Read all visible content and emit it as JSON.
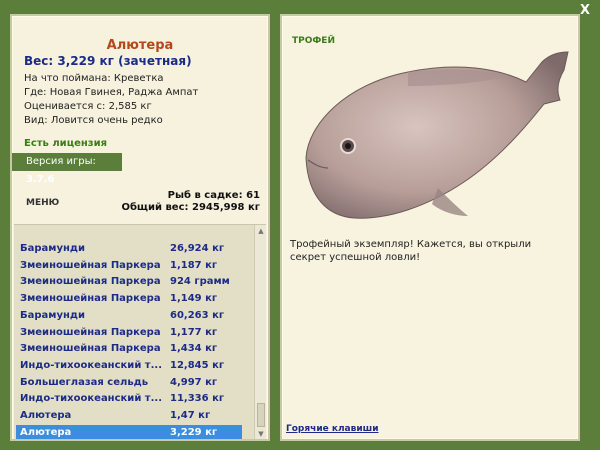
{
  "close_label": "X",
  "fish": {
    "name": "Алютера",
    "weight": "Вес: 3,229 кг (зачетная)",
    "bait": "На что поймана: Креветка",
    "place": "Где: Новая Гвинея, Раджа Ампат",
    "price": "Оценивается с: 2,585 кг",
    "rarity": "Вид: Ловится очень редко"
  },
  "license": "Есть лицензия",
  "version": {
    "label": "Версия игры:",
    "value": "3.7.6"
  },
  "menu_label": "МЕНЮ",
  "stats": {
    "count": "Рыб в садке: 61",
    "total": "Общий вес: 2945,998 кг"
  },
  "catch_list": [
    {
      "name": "Барамунди",
      "weight": "26,924 кг"
    },
    {
      "name": "Змеиношейная Паркера",
      "weight": "1,187 кг"
    },
    {
      "name": "Змеиношейная Паркера",
      "weight": "924 грамм"
    },
    {
      "name": "Змеиношейная Паркера",
      "weight": "1,149 кг"
    },
    {
      "name": "Барамунди",
      "weight": "60,263 кг"
    },
    {
      "name": "Змеиношейная Паркера",
      "weight": "1,177 кг"
    },
    {
      "name": "Змеиношейная Паркера",
      "weight": "1,434 кг"
    },
    {
      "name": "Индо-тихоокеанский т...",
      "weight": "12,845 кг"
    },
    {
      "name": "Большеглазая сельдь",
      "weight": "4,997 кг"
    },
    {
      "name": "Индо-тихоокеанский т...",
      "weight": "11,336 кг"
    },
    {
      "name": "Алютера",
      "weight": "1,47 кг"
    },
    {
      "name": "Алютера",
      "weight": "3,229 кг",
      "selected": true
    }
  ],
  "trophy_label": "ТРОФЕЙ",
  "description": "Трофейный экземпляр! Кажется, вы открыли секрет успешной ловли!",
  "hotkeys_label": "Горячие клавиши",
  "colors": {
    "background": "#5b7f3a",
    "panel": "#f6f2de",
    "title": "#b3491b",
    "list_text": "#1c2b86",
    "selection": "#3b8de0",
    "license": "#3c7a1a"
  }
}
